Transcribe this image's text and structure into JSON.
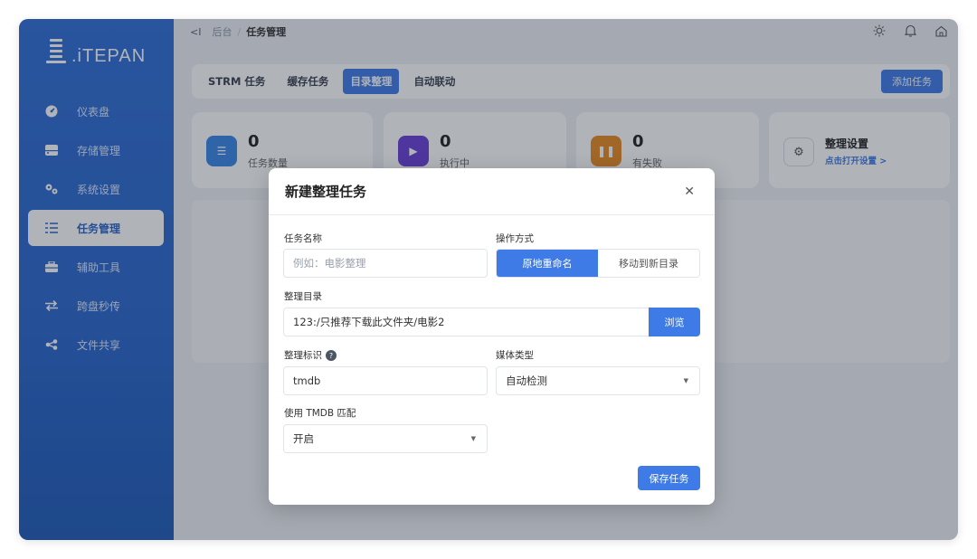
{
  "app": {
    "logo_text": ".iTEPAN"
  },
  "sidebar": {
    "items": [
      {
        "label": "仪表盘",
        "icon": "dashboard-icon"
      },
      {
        "label": "存储管理",
        "icon": "storage-icon"
      },
      {
        "label": "系统设置",
        "icon": "gears-icon"
      },
      {
        "label": "任务管理",
        "icon": "task-list-icon",
        "active": true
      },
      {
        "label": "辅助工具",
        "icon": "toolbox-icon"
      },
      {
        "label": "跨盘秒传",
        "icon": "transfer-icon"
      },
      {
        "label": "文件共享",
        "icon": "share-icon"
      }
    ]
  },
  "breadcrumb": {
    "root": "后台",
    "current": "任务管理"
  },
  "tabs": [
    {
      "label": "STRM 任务"
    },
    {
      "label": "缓存任务"
    },
    {
      "label": "目录整理",
      "active": true
    },
    {
      "label": "自动联动"
    }
  ],
  "add_task_label": "添加任务",
  "stats": [
    {
      "value": "0",
      "label": "任务数量",
      "color": "#3a86e6"
    },
    {
      "value": "0",
      "label": "执行中",
      "color": "#6b3fd8"
    },
    {
      "value": "0",
      "label": "有失败",
      "color": "#e98a22"
    }
  ],
  "settings_card": {
    "title": "整理设置",
    "link": "点击打开设置 >"
  },
  "modal": {
    "title": "新建整理任务",
    "task_name_label": "任务名称",
    "task_name_placeholder": "例如：电影整理",
    "operation_label": "操作方式",
    "operation_options": [
      "原地重命名",
      "移动到新目录"
    ],
    "dir_label": "整理目录",
    "dir_value": "123:/只推荐下载此文件夹/电影2",
    "browse_label": "浏览",
    "tag_label": "整理标识",
    "tag_value": "tmdb",
    "media_type_label": "媒体类型",
    "media_type_value": "自动检测",
    "tmdb_label": "使用 TMDB 匹配",
    "tmdb_value": "开启",
    "save_label": "保存任务"
  },
  "colors": {
    "accent": "#3f7be6",
    "sidebar": "#2a66cc"
  }
}
